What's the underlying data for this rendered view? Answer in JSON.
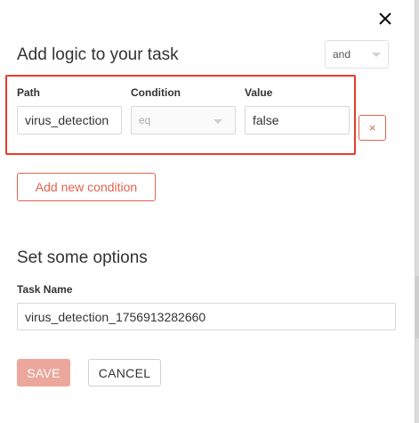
{
  "logic": {
    "title": "Add logic to your task",
    "operator": "and"
  },
  "condition": {
    "path_label": "Path",
    "condition_label": "Condition",
    "value_label": "Value",
    "path_value": "virus_detection",
    "condition_value": "eq",
    "value_value": "false",
    "remove_label": "×"
  },
  "add_condition_label": "Add new condition",
  "options": {
    "title": "Set some options",
    "task_name_label": "Task Name",
    "task_name_value": "virus_detection_1756913282660"
  },
  "buttons": {
    "save": "SAVE",
    "cancel": "CANCEL"
  },
  "colors": {
    "accent": "#e0634f",
    "highlight_border": "#e53b2c",
    "save_disabled": "#eba79b"
  }
}
